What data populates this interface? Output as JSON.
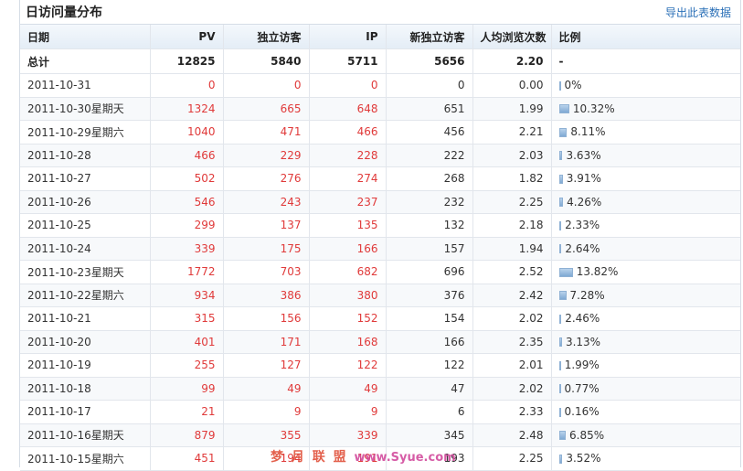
{
  "header": {
    "title": "日访问量分布",
    "export_label": "导出此表数据"
  },
  "columns": [
    "日期",
    "PV",
    "独立访客",
    "IP",
    "新独立访客",
    "人均浏览次数",
    "比例"
  ],
  "total": {
    "date": "总计",
    "pv": "12825",
    "uv": "5840",
    "ip": "5711",
    "new": "5656",
    "avg": "2.20",
    "ratio": "-"
  },
  "rows": [
    {
      "date": "2011-10-31",
      "pv": "0",
      "uv": "0",
      "ip": "0",
      "new": "0",
      "avg": "0.00",
      "ratio": "0%",
      "pct": 0
    },
    {
      "date": "2011-10-30星期天",
      "pv": "1324",
      "uv": "665",
      "ip": "648",
      "new": "651",
      "avg": "1.99",
      "ratio": "10.32%",
      "pct": 10.32
    },
    {
      "date": "2011-10-29星期六",
      "pv": "1040",
      "uv": "471",
      "ip": "466",
      "new": "456",
      "avg": "2.21",
      "ratio": "8.11%",
      "pct": 8.11
    },
    {
      "date": "2011-10-28",
      "pv": "466",
      "uv": "229",
      "ip": "228",
      "new": "222",
      "avg": "2.03",
      "ratio": "3.63%",
      "pct": 3.63
    },
    {
      "date": "2011-10-27",
      "pv": "502",
      "uv": "276",
      "ip": "274",
      "new": "268",
      "avg": "1.82",
      "ratio": "3.91%",
      "pct": 3.91
    },
    {
      "date": "2011-10-26",
      "pv": "546",
      "uv": "243",
      "ip": "237",
      "new": "232",
      "avg": "2.25",
      "ratio": "4.26%",
      "pct": 4.26
    },
    {
      "date": "2011-10-25",
      "pv": "299",
      "uv": "137",
      "ip": "135",
      "new": "132",
      "avg": "2.18",
      "ratio": "2.33%",
      "pct": 2.33
    },
    {
      "date": "2011-10-24",
      "pv": "339",
      "uv": "175",
      "ip": "166",
      "new": "157",
      "avg": "1.94",
      "ratio": "2.64%",
      "pct": 2.64
    },
    {
      "date": "2011-10-23星期天",
      "pv": "1772",
      "uv": "703",
      "ip": "682",
      "new": "696",
      "avg": "2.52",
      "ratio": "13.82%",
      "pct": 13.82
    },
    {
      "date": "2011-10-22星期六",
      "pv": "934",
      "uv": "386",
      "ip": "380",
      "new": "376",
      "avg": "2.42",
      "ratio": "7.28%",
      "pct": 7.28
    },
    {
      "date": "2011-10-21",
      "pv": "315",
      "uv": "156",
      "ip": "152",
      "new": "154",
      "avg": "2.02",
      "ratio": "2.46%",
      "pct": 2.46
    },
    {
      "date": "2011-10-20",
      "pv": "401",
      "uv": "171",
      "ip": "168",
      "new": "166",
      "avg": "2.35",
      "ratio": "3.13%",
      "pct": 3.13
    },
    {
      "date": "2011-10-19",
      "pv": "255",
      "uv": "127",
      "ip": "122",
      "new": "122",
      "avg": "2.01",
      "ratio": "1.99%",
      "pct": 1.99
    },
    {
      "date": "2011-10-18",
      "pv": "99",
      "uv": "49",
      "ip": "49",
      "new": "47",
      "avg": "2.02",
      "ratio": "0.77%",
      "pct": 0.77
    },
    {
      "date": "2011-10-17",
      "pv": "21",
      "uv": "9",
      "ip": "9",
      "new": "6",
      "avg": "2.33",
      "ratio": "0.16%",
      "pct": 0.16
    },
    {
      "date": "2011-10-16星期天",
      "pv": "879",
      "uv": "355",
      "ip": "339",
      "new": "345",
      "avg": "2.48",
      "ratio": "6.85%",
      "pct": 6.85
    },
    {
      "date": "2011-10-15星期六",
      "pv": "451",
      "uv": "194",
      "ip": "191",
      "new": "193",
      "avg": "2.25",
      "ratio": "3.52%",
      "pct": 3.52
    }
  ],
  "watermark": {
    "text": "梦 月 联 盟",
    "url": "www.Syue.com"
  },
  "colors": {
    "value_red": "#e03a3a",
    "link_blue": "#2a6fb7",
    "bar": "#7fa9d3"
  }
}
